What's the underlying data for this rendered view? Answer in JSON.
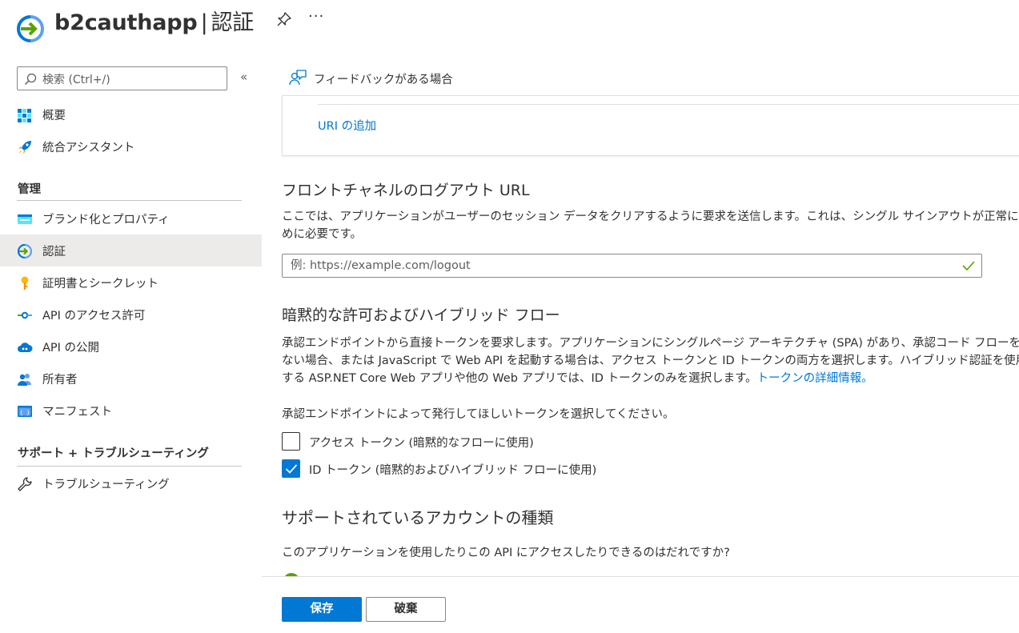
{
  "header": {
    "app_name": "b2cauthapp",
    "separator": "|",
    "page_title": "認証",
    "more_label": "···"
  },
  "sidebar": {
    "search_placeholder": "検索 (Ctrl+/)",
    "collapse_label": "«",
    "top_items": [
      {
        "label": "概要",
        "icon": "overview-grid-icon"
      },
      {
        "label": "統合アシスタント",
        "icon": "rocket-icon"
      }
    ],
    "sections": [
      {
        "title": "管理",
        "items": [
          {
            "label": "ブランド化とプロパティ",
            "icon": "branding-icon"
          },
          {
            "label": "認証",
            "icon": "authentication-icon",
            "active": true
          },
          {
            "label": "証明書とシークレット",
            "icon": "key-icon"
          },
          {
            "label": "API のアクセス許可",
            "icon": "api-permissions-icon"
          },
          {
            "label": "API の公開",
            "icon": "cloud-icon"
          },
          {
            "label": "所有者",
            "icon": "owners-icon"
          },
          {
            "label": "マニフェスト",
            "icon": "manifest-icon"
          }
        ]
      },
      {
        "title": "サポート + トラブルシューティング",
        "items": [
          {
            "label": "トラブルシューティング",
            "icon": "wrench-icon"
          }
        ]
      }
    ]
  },
  "main": {
    "feedback_label": "フィードバックがある場合",
    "add_uri_link": "URI の追加",
    "front_channel": {
      "heading": "フロントチャネルのログアウト URL",
      "desc_line1": "ここでは、アプリケーションがユーザーのセッション データをクリアするように要求を送信します。これは、シングル サインアウトが正常に動作するた",
      "desc_line2": "めに必要です。",
      "placeholder": "例: https://example.com/logout"
    },
    "implicit": {
      "heading": "暗黙的な許可およびハイブリッド フロー",
      "desc_line1": "承認エンドポイントから直接トークンを要求します。アプリケーションにシングルページ アーキテクチャ (SPA) があり、承認コード フローを使用してい",
      "desc_line2": "ない場合、または JavaScript で Web API を起動する場合は、アクセス トークンと ID トークンの両方を選択します。ハイブリッド認証を使用",
      "desc_line3": "する ASP.NET Core Web アプリや他の Web アプリでは、ID トークンのみを選択します。",
      "link": "トークンの詳細情報。",
      "prompt": "承認エンドポイントによって発行してほしいトークンを選択してください。",
      "options": [
        {
          "label": "アクセス トークン (暗黙的なフローに使用)",
          "checked": false
        },
        {
          "label": "ID トークン (暗黙的およびハイブリッド フローに使用)",
          "checked": true
        }
      ]
    },
    "account_types": {
      "heading": "サポートされているアカウントの種類",
      "question": "このアプリケーションを使用したりこの API にアクセスしたりできるのはだれですか?"
    }
  },
  "footer": {
    "save_label": "保存",
    "discard_label": "破棄"
  },
  "colors": {
    "accent": "#0078d4",
    "active_nav_bg": "#edebe9",
    "valid_check": "#57a300"
  }
}
